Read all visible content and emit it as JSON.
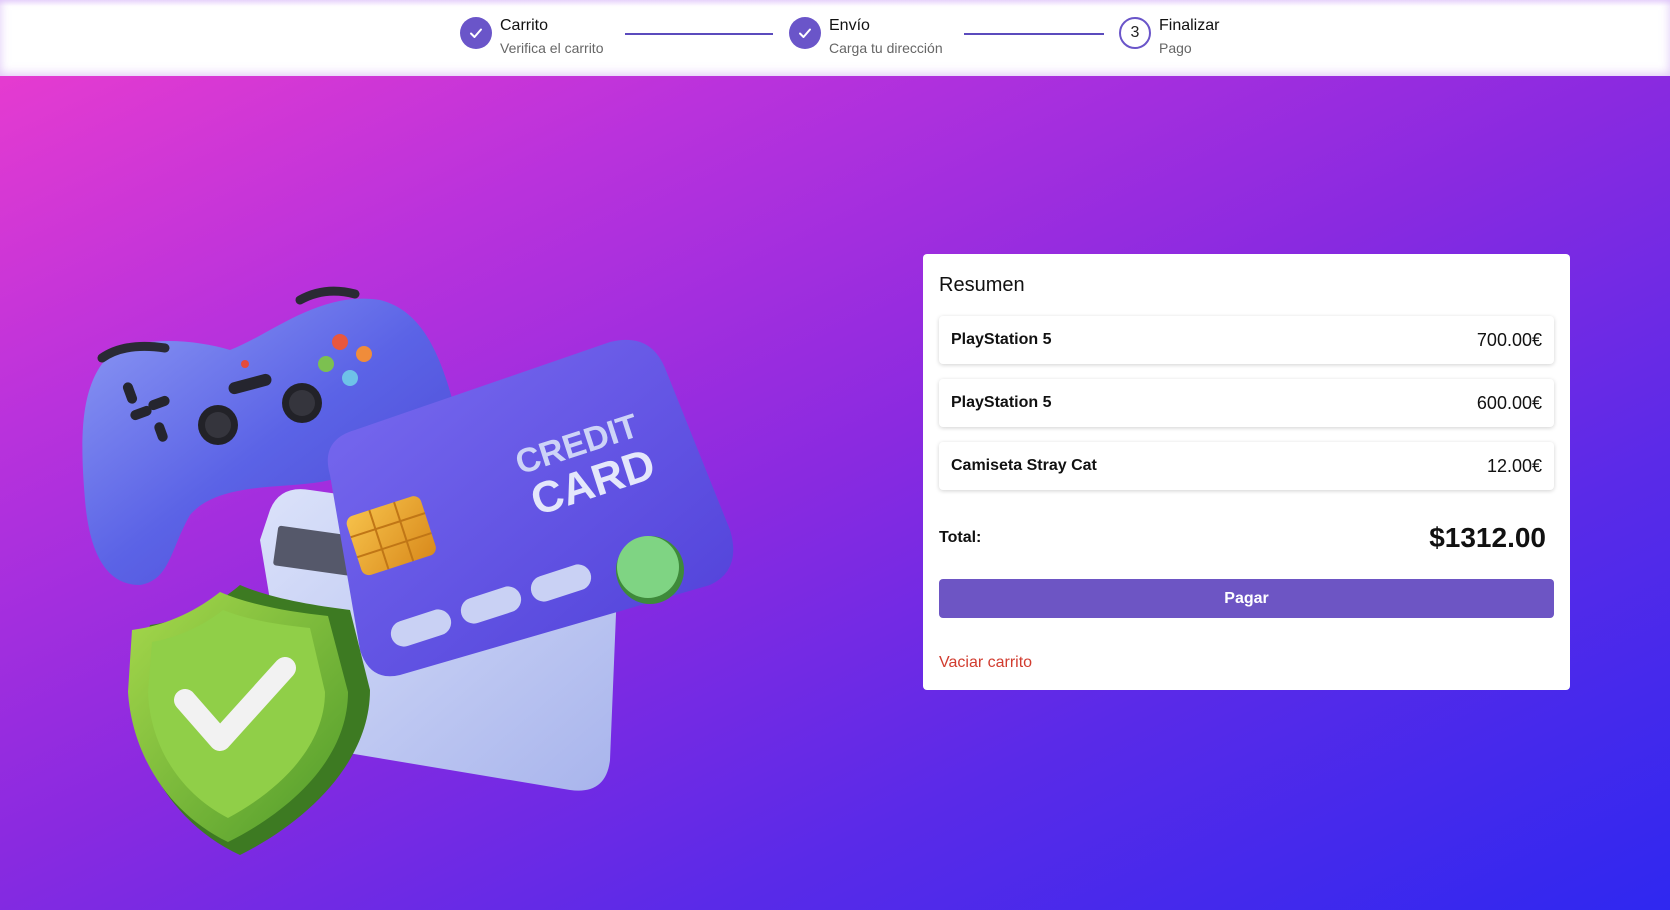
{
  "stepper": {
    "steps": [
      {
        "title": "Carrito",
        "subtitle": "Verifica el carrito",
        "status": "done"
      },
      {
        "title": "Envío",
        "subtitle": "Carga tu dirección",
        "status": "done"
      },
      {
        "title": "Finalizar",
        "subtitle": "Pago",
        "status": "current",
        "number": "3"
      }
    ]
  },
  "illustration": {
    "card_text_line1": "CREDIT",
    "card_text_line2": "CARD"
  },
  "summary": {
    "title": "Resumen",
    "items": [
      {
        "name": "PlayStation 5",
        "price": "700.00€"
      },
      {
        "name": "PlayStation 5",
        "price": "600.00€"
      },
      {
        "name": "Camiseta Stray Cat",
        "price": "12.00€"
      }
    ],
    "total_label": "Total:",
    "total_value": "$1312.00",
    "pay_label": "Pagar",
    "empty_cart_label": "Vaciar carrito"
  },
  "colors": {
    "accent": "#6d55c4",
    "danger": "#d13c2f",
    "gradient_start": "#e53bd0",
    "gradient_end": "#2f28f0"
  }
}
